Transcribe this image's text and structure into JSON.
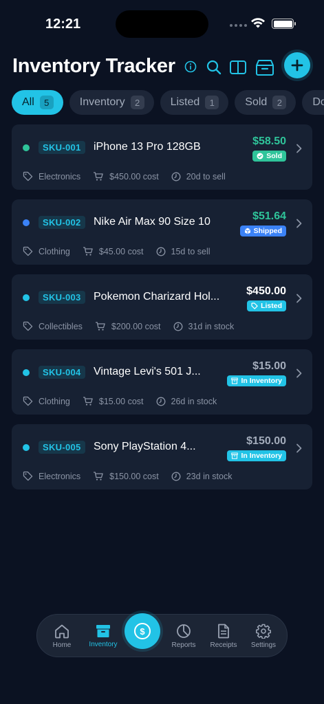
{
  "status_bar": {
    "time": "12:21"
  },
  "header": {
    "title": "Inventory Tracker",
    "icons": [
      "info-icon",
      "search-icon",
      "split-view-icon",
      "storage-box-icon",
      "plus-icon"
    ]
  },
  "colors": {
    "accent": "#22c3e6",
    "sold_green": "#2fc49a",
    "shipped_blue": "#3b82f6",
    "background": "#0b1222",
    "card": "#172133"
  },
  "filters": [
    {
      "label": "All",
      "count": "5"
    },
    {
      "label": "Inventory",
      "count": "2"
    },
    {
      "label": "Listed",
      "count": "1"
    },
    {
      "label": "Sold",
      "count": "2"
    },
    {
      "label": "Do",
      "count": ""
    }
  ],
  "items": [
    {
      "sku": "SKU-001",
      "name": "iPhone 13 Pro 128GB",
      "price": "$58.50",
      "status": "Sold",
      "category": "Electronics",
      "cost": "$450.00 cost",
      "days": "20d to sell"
    },
    {
      "sku": "SKU-002",
      "name": "Nike Air Max 90 Size 10",
      "price": "$51.64",
      "status": "Shipped",
      "category": "Clothing",
      "cost": "$45.00 cost",
      "days": "15d to sell"
    },
    {
      "sku": "SKU-003",
      "name": "Pokemon Charizard Hol...",
      "price": "$450.00",
      "status": "Listed",
      "category": "Collectibles",
      "cost": "$200.00 cost",
      "days": "31d in stock"
    },
    {
      "sku": "SKU-004",
      "name": "Vintage Levi's 501 J...",
      "price": "$15.00",
      "status": "In Inventory",
      "category": "Clothing",
      "cost": "$15.00 cost",
      "days": "26d in stock"
    },
    {
      "sku": "SKU-005",
      "name": "Sony PlayStation 4...",
      "price": "$150.00",
      "status": "In Inventory",
      "category": "Electronics",
      "cost": "$150.00 cost",
      "days": "23d in stock"
    }
  ],
  "tabbar": {
    "home": "Home",
    "inventory": "Inventory",
    "fab_symbol": "$",
    "reports": "Reports",
    "receipts": "Receipts",
    "settings": "Settings"
  }
}
